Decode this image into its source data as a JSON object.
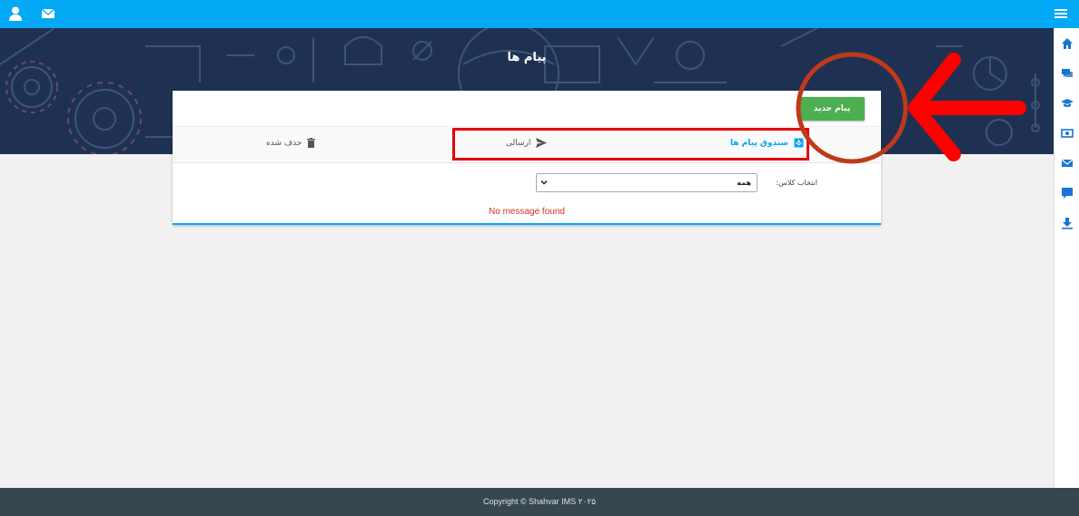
{
  "header": {
    "user_icon": "user-icon",
    "mail_icon": "mail-icon",
    "menu_icon": "hamburger-menu-icon"
  },
  "page": {
    "title": "پیام ها"
  },
  "toolbar": {
    "new_message_label": "پیام جدید"
  },
  "tabs": [
    {
      "label": "صندوق پیام ها",
      "icon": "inbox-icon",
      "active": true
    },
    {
      "label": "ارسالی",
      "icon": "send-icon",
      "active": false
    },
    {
      "label": "حذف شده",
      "icon": "trash-icon",
      "active": false
    }
  ],
  "filter": {
    "label": "انتخاب کلاس:",
    "selected": "همه"
  },
  "messages": {
    "empty_text": "No message found"
  },
  "sidebar": {
    "items": [
      {
        "icon": "home-icon"
      },
      {
        "icon": "chat-icon"
      },
      {
        "icon": "graduation-cap-icon"
      },
      {
        "icon": "money-icon"
      },
      {
        "icon": "mail-icon"
      },
      {
        "icon": "comment-icon"
      },
      {
        "icon": "download-icon"
      }
    ]
  },
  "footer": {
    "copyright": "Copyright © Shahvar IMS ۲۰۲۵"
  },
  "colors": {
    "topbar": "#03a9f4",
    "banner": "#1f3152",
    "accent": "#03a9f4",
    "new_button": "#4caf50",
    "footer": "#37474f",
    "annotation_red": "#e3000b",
    "annotation_circle": "#c0391b"
  }
}
